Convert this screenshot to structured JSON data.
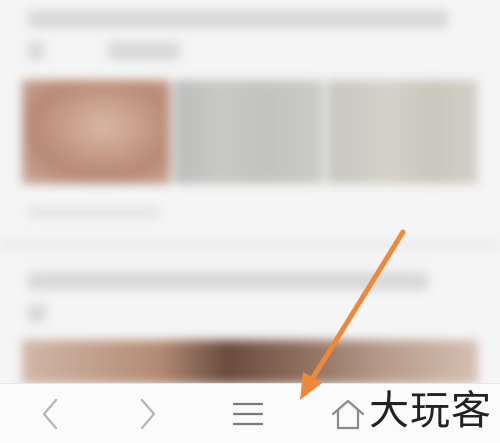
{
  "bottom_nav": {
    "items": [
      {
        "id": "back",
        "icon": "chevron-left-icon"
      },
      {
        "id": "forward",
        "icon": "chevron-right-icon"
      },
      {
        "id": "menu",
        "icon": "hamburger-menu-icon"
      },
      {
        "id": "home",
        "icon": "home-icon"
      }
    ]
  },
  "watermark": {
    "text": "大玩客"
  },
  "annotation": {
    "arrow_color": "#f0883a",
    "target": "menu"
  },
  "colors": {
    "background": "#f5f5f5",
    "nav_bar": "#fbfbfb",
    "nav_icon": "#b5b5b5"
  }
}
